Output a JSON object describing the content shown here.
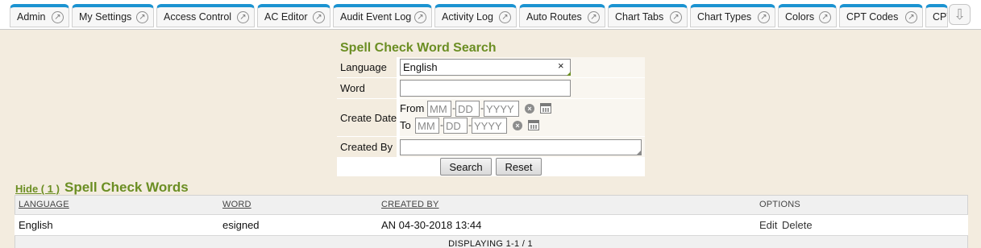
{
  "tabs": [
    {
      "label": "Admin"
    },
    {
      "label": "My Settings"
    },
    {
      "label": "Access Control"
    },
    {
      "label": "AC Editor"
    },
    {
      "label": "Audit Event Log"
    },
    {
      "label": "Activity Log"
    },
    {
      "label": "Auto Routes"
    },
    {
      "label": "Chart Tabs"
    },
    {
      "label": "Chart Types"
    },
    {
      "label": "Colors"
    },
    {
      "label": "CPT Codes"
    },
    {
      "label": "CPT Groups"
    }
  ],
  "icons": {
    "tab_popout": "↗",
    "more_tabs": "⇩",
    "clear": "×",
    "clear_date": "×"
  },
  "search": {
    "title": "Spell Check Word Search",
    "language_label": "Language",
    "language_value": "English",
    "word_label": "Word",
    "word_value": "",
    "create_date_label": "Create Date",
    "from_label": "From",
    "to_label": "To",
    "mm_placeholder": "MM",
    "dd_placeholder": "DD",
    "yyyy_placeholder": "YYYY",
    "created_by_label": "Created By",
    "created_by_value": "",
    "search_button": "Search",
    "reset_button": "Reset"
  },
  "results": {
    "hide_link": "Hide ( 1 )",
    "title": "Spell Check Words",
    "columns": [
      "LANGUAGE",
      "WORD",
      "CREATED BY",
      "OPTIONS"
    ],
    "rows": [
      {
        "language": "English",
        "word": "esigned",
        "created_by": "AN 04-30-2018 13:44",
        "edit": "Edit",
        "delete": "Delete"
      }
    ],
    "footer": "DISPLAYING 1-1 / 1"
  },
  "colors": {
    "accent_green": "#6b8e23",
    "tab_blue": "#1b93d1",
    "background": "#f3ecdf"
  }
}
